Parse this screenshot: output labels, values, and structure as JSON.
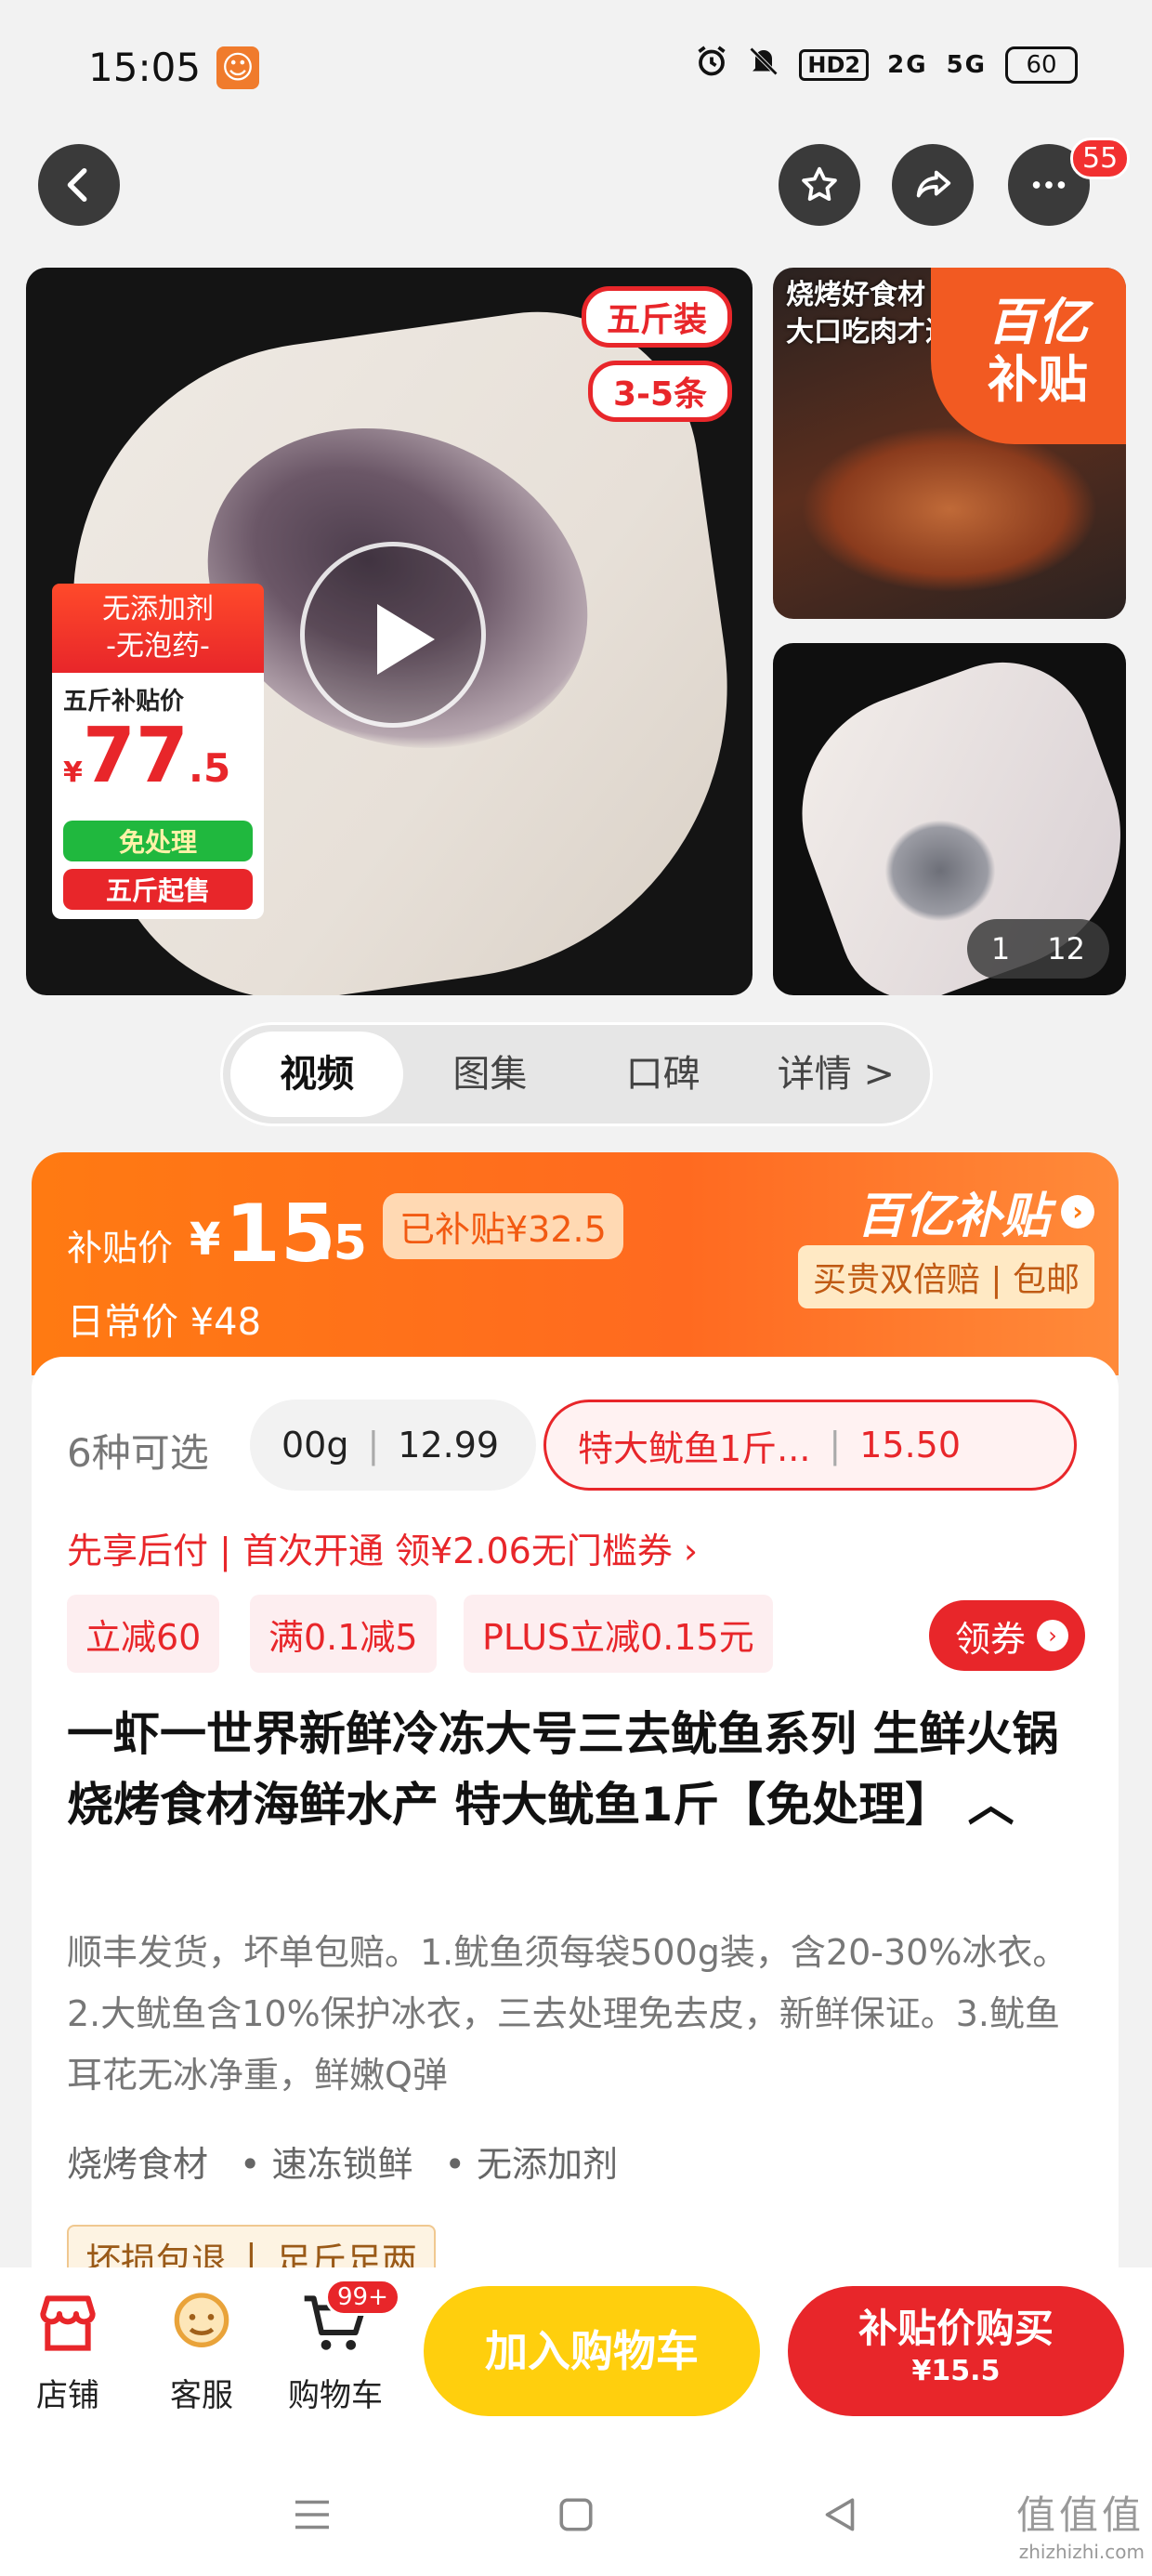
{
  "status_bar": {
    "time": "15:05",
    "app_icon_glyph": "☺",
    "hd_label": "HD2",
    "signal_2g": "2G",
    "signal_5g": "5G",
    "battery": "60",
    "icons": [
      "alarm-icon",
      "mute-icon",
      "signal-icon",
      "battery-icon"
    ]
  },
  "nav": {
    "more_badge": "55",
    "icons": [
      "chevron-left-icon",
      "star-icon",
      "share-icon",
      "more-icon"
    ]
  },
  "gallery": {
    "tag_1": "五斤装",
    "tag_2": "3-5条",
    "promo_banner_1": "无添加剂",
    "promo_banner_2": "-无泡药-",
    "promo_label": "五斤补贴价",
    "promo_currency": "¥",
    "promo_int": "77",
    "promo_dec": ".5",
    "chip_green": "免处理",
    "chip_red": "五斤起售",
    "thumb1_text_1": "烧烤好食材",
    "thumb1_text_2": "大口吃肉才过",
    "thumb1_badge_1": "百亿",
    "thumb1_badge_2": "补贴",
    "counter_current": "1",
    "counter_total": "12"
  },
  "tabs": [
    {
      "label": "视频",
      "active": true
    },
    {
      "label": "图集",
      "active": false
    },
    {
      "label": "口碑",
      "active": false
    },
    {
      "label": "详情 >",
      "active": false
    }
  ],
  "price": {
    "label": "补贴价",
    "currency": "¥",
    "int": "15",
    "dec": ".5",
    "saved": "已补贴¥32.5",
    "daily": "日常价 ¥48",
    "brand": "百亿补贴",
    "brand_chev": "›",
    "guarantee": "买贵双倍赔 | 包邮"
  },
  "sku": {
    "count": "6种可选",
    "option_1_name": "00g",
    "option_1_price": "12.99",
    "option_2_name": "特大鱿鱼1斤...",
    "option_2_price": "15.50"
  },
  "paylater": "先享后付 | 首次开通 领¥2.06无门槛券 ›",
  "promo_tags": [
    "立减60",
    "满0.1减5",
    "PLUS立减0.15元"
  ],
  "coupon": {
    "label": "领券",
    "chev": "›"
  },
  "product": {
    "title": "一虾一世界新鲜冷冻大号三去鱿鱼系列 生鲜火锅烧烤食材海鲜水产 特大鱿鱼1斤【免处理】 ︿",
    "description": "顺丰发货，坏单包赔。1.鱿鱼须每袋500g装，含20-30%冰衣。2.大鱿鱼含10%保护冰衣，三去处理免去皮，新鲜保证。3.鱿鱼耳花无冰净重，鲜嫩Q弹",
    "features": [
      "烧烤食材",
      "• 速冻锁鲜",
      "• 无添加剂"
    ],
    "assurance_1": "坏损包退",
    "assurance_2": "足斤足两"
  },
  "bottom_bar": {
    "store": "店铺",
    "service": "客服",
    "cart": "购物车",
    "cart_badge": "99+",
    "add_to_cart": "加入购物车",
    "buy_line_1": "补贴价购买",
    "buy_line_2": "¥15.5"
  },
  "watermark": {
    "line_1": "值值值",
    "line_2": "zhizhizhi.com"
  },
  "colors": {
    "accent_red": "#e8262a",
    "accent_orange": "#ff7a12",
    "accent_yellow": "#ffcf0d"
  }
}
